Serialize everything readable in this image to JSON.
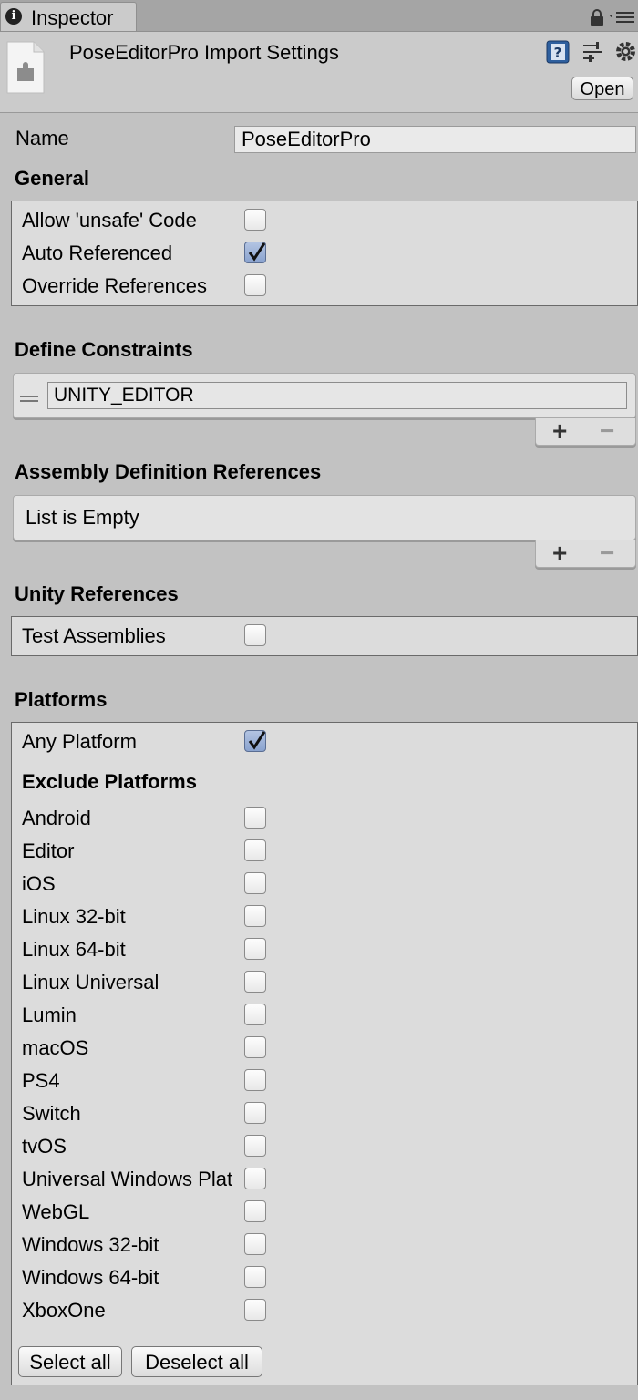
{
  "tab": {
    "label": "Inspector"
  },
  "header": {
    "title": "PoseEditorPro Import Settings",
    "open_label": "Open"
  },
  "name": {
    "label": "Name",
    "value": "PoseEditorPro"
  },
  "general": {
    "heading": "General",
    "options": [
      {
        "label": "Allow 'unsafe' Code",
        "checked": false
      },
      {
        "label": "Auto Referenced",
        "checked": true
      },
      {
        "label": "Override References",
        "checked": false
      }
    ]
  },
  "define_constraints": {
    "heading": "Define Constraints",
    "items": [
      "UNITY_EDITOR"
    ],
    "add_label": "+",
    "remove_label": "−"
  },
  "assembly_refs": {
    "heading": "Assembly Definition References",
    "empty_text": "List is Empty",
    "add_label": "+",
    "remove_label": "−"
  },
  "unity_refs": {
    "heading": "Unity References",
    "test_assemblies": {
      "label": "Test Assemblies",
      "checked": false
    }
  },
  "platforms": {
    "heading": "Platforms",
    "any_platform": {
      "label": "Any Platform",
      "checked": true
    },
    "exclude_heading": "Exclude Platforms",
    "items": [
      {
        "label": "Android",
        "checked": false
      },
      {
        "label": "Editor",
        "checked": false
      },
      {
        "label": "iOS",
        "checked": false
      },
      {
        "label": "Linux 32-bit",
        "checked": false
      },
      {
        "label": "Linux 64-bit",
        "checked": false
      },
      {
        "label": "Linux Universal",
        "checked": false
      },
      {
        "label": "Lumin",
        "checked": false
      },
      {
        "label": "macOS",
        "checked": false
      },
      {
        "label": "PS4",
        "checked": false
      },
      {
        "label": "Switch",
        "checked": false
      },
      {
        "label": "tvOS",
        "checked": false
      },
      {
        "label": "Universal Windows Plat",
        "checked": false
      },
      {
        "label": "WebGL",
        "checked": false
      },
      {
        "label": "Windows 32-bit",
        "checked": false
      },
      {
        "label": "Windows 64-bit",
        "checked": false
      },
      {
        "label": "XboxOne",
        "checked": false
      }
    ],
    "select_all_label": "Select all",
    "deselect_all_label": "Deselect all"
  }
}
